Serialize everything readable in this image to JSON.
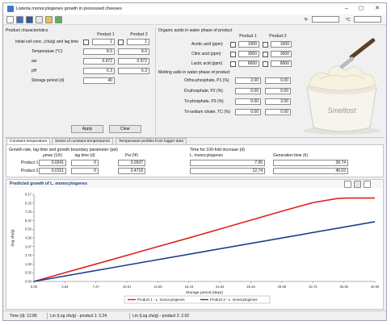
{
  "window": {
    "title": "Listeria monocytogenes growth in processed cheeses"
  },
  "toolbar": {
    "temp_unit_f": "°F",
    "temp_unit_c": "°C"
  },
  "product": {
    "heading": "Product characteristics",
    "col1": "Product 1",
    "col2": "Product 2",
    "rows": [
      {
        "label": "Initial cell conc. (cfu/g) and lag time",
        "p1": "1",
        "p2": "1"
      },
      {
        "label": "Temperature (°C)",
        "p1": "8.0",
        "p2": "8.0"
      },
      {
        "label": "aw",
        "p1": "0.972",
        "p2": "0.972"
      },
      {
        "label": "pH",
        "p1": "6.3",
        "p2": "6.3"
      },
      {
        "label": "Storage period (d)",
        "p1": "40",
        "p2": ""
      }
    ],
    "apply": "Apply",
    "clear": "Clear"
  },
  "organic": {
    "heading": "Organic acids in water phase of product",
    "col1": "Product 1",
    "col2": "Product 2",
    "rows": [
      {
        "label": "Acetic acid (ppm)",
        "p1": "1000",
        "p2": "1000"
      },
      {
        "label": "Citric acid (ppm)",
        "p1": "3000",
        "p2": "3000"
      },
      {
        "label": "Lactic acid (ppm)",
        "p1": "8000",
        "p2": "8000"
      }
    ],
    "melting_heading": "Melting salts in water phase of product",
    "melting_rows": [
      {
        "label": "Ortho-phosphate, P1 (%)",
        "p1": "2.00",
        "p2": "0.00"
      },
      {
        "label": "Di-phosphate, P2 (%)",
        "p1": "0.00",
        "p2": "0.00"
      },
      {
        "label": "Tri-phosphate, P3 (%)",
        "p1": "0.00",
        "p2": "2.00"
      },
      {
        "label": "Tri-sodium citrate, TC (%)",
        "p1": "0.00",
        "p2": "0.00"
      }
    ],
    "brand": "Smeltost"
  },
  "tabs": [
    "Constant temperature",
    "Series of constant temperatures",
    "Temperature profiles from logger data"
  ],
  "growth": {
    "heading": "Growth rate, lag time and growth boundary parameter (psi)",
    "cols": [
      "μmax (1/h)",
      "lag time (d)",
      "Psi (Ψ)"
    ],
    "rows": [
      {
        "label": "Product 1",
        "values": [
          "0.0241",
          "0",
          "0.2637"
        ]
      },
      {
        "label": "Product 2",
        "values": [
          "0.0151",
          "0",
          "0.4718"
        ]
      }
    ]
  },
  "increase": {
    "heading": "Time for 100-fold increase (d)",
    "cols": [
      "L. monocytogenes",
      "Generation time (h)"
    ],
    "rows": [
      {
        "values": [
          "7.95",
          "28.74"
        ]
      },
      {
        "values": [
          "12.74",
          "46.03"
        ]
      }
    ]
  },
  "plot_header": "Predicted growth of L. monocytogenes",
  "chart_data": {
    "type": "line",
    "title": "",
    "xlabel": "Storage period (days)",
    "ylabel": "(log cfu/g)",
    "xlim": [
      0,
      40
    ],
    "ylim": [
      0,
      9.17
    ],
    "x_ticks": [
      "0.00",
      "3.64",
      "7.27",
      "10.91",
      "14.55",
      "18.18",
      "21.82",
      "25.45",
      "29.09",
      "32.73",
      "36.36",
      "40.00"
    ],
    "y_ticks": [
      "0.00",
      "0.92",
      "1.83",
      "2.75",
      "3.67",
      "4.58",
      "5.50",
      "6.42",
      "7.33",
      "8.25",
      "9.17"
    ],
    "grid": false,
    "legend": "bottom-center",
    "series": [
      {
        "name": "Product 1 - L. monocytogenes",
        "color": "#e0201c",
        "x": [
          0,
          3.64,
          7.27,
          10.91,
          14.55,
          18.18,
          21.82,
          25.45,
          29.09,
          32.73,
          35.5,
          36.36,
          37.0,
          40.0
        ],
        "y": [
          0.0,
          0.92,
          1.83,
          2.75,
          3.67,
          4.58,
          5.52,
          6.45,
          7.4,
          8.3,
          8.72,
          8.77,
          8.78,
          8.78
        ]
      },
      {
        "name": "Product 2 - L. monocytogenes",
        "color": "#1f3f8c",
        "x": [
          0,
          10,
          20,
          30,
          40
        ],
        "y": [
          0.0,
          1.58,
          3.15,
          4.72,
          6.29
        ]
      }
    ]
  },
  "status": {
    "time": "Time (d): 12.89",
    "p1": "Lm (Log cfu/g) - product 1: 3.24",
    "p2": "Lm (Log cfu/g) - product 2: 2.02"
  }
}
